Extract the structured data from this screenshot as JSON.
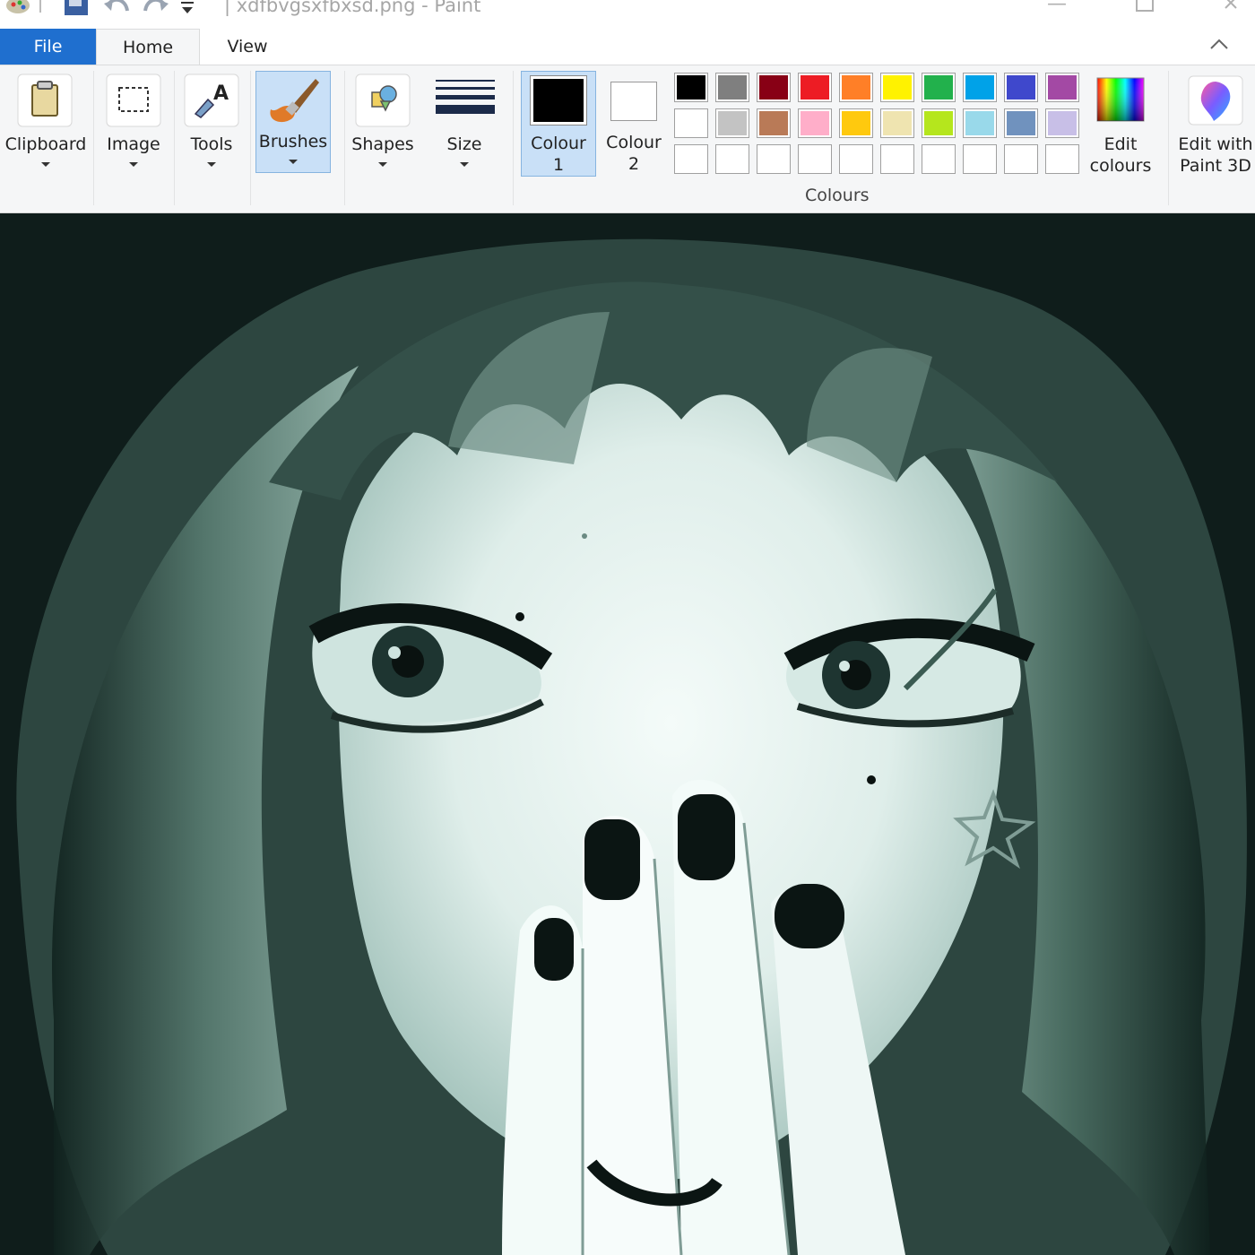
{
  "window": {
    "title": "| xdfbvgsxfbxsd.png - Paint"
  },
  "tabs": {
    "file": "File",
    "home": "Home",
    "view": "View"
  },
  "ribbon": {
    "clipboard": "Clipboard",
    "image": "Image",
    "tools": "Tools",
    "brushes": "Brushes",
    "shapes": "Shapes",
    "size": "Size",
    "colour1_line1": "Colour",
    "colour1_line2": "1",
    "colour2_line1": "Colour",
    "colour2_line2": "2",
    "edit_colours_line1": "Edit",
    "edit_colours_line2": "colours",
    "paint3d_line1": "Edit with",
    "paint3d_line2": "Paint 3D",
    "colours_group": "Colours"
  },
  "colors": {
    "colour1": "#000000",
    "colour2": "#ffffff",
    "accent": "#1f6fcf"
  },
  "palette_row1": [
    "#000000",
    "#7f7f7f",
    "#880015",
    "#ed1c24",
    "#ff7f27",
    "#fff200",
    "#22b14c",
    "#00a2e8",
    "#3f48cc",
    "#a349a4"
  ],
  "palette_row2": [
    "#ffffff",
    "#c3c3c3",
    "#b97a57",
    "#ffaec9",
    "#ffc90e",
    "#efe4b0",
    "#b5e61d",
    "#99d9ea",
    "#7092be",
    "#c8bfe7"
  ],
  "palette_row3": [
    "#ffffff",
    "#ffffff",
    "#ffffff",
    "#ffffff",
    "#ffffff",
    "#ffffff",
    "#ffffff",
    "#ffffff",
    "#ffffff",
    "#ffffff"
  ]
}
